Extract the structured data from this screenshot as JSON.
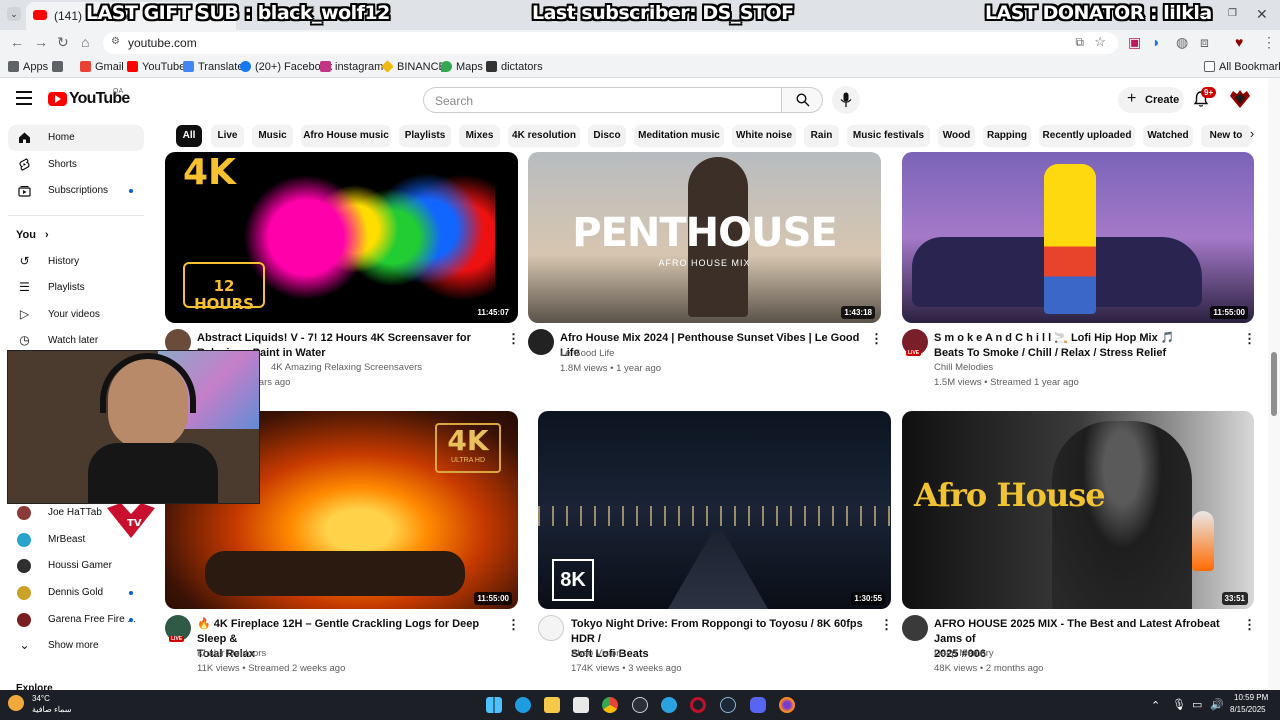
{
  "browser": {
    "tab_title": "(141) YouTube",
    "url": "youtube.com",
    "bookmarks": [
      {
        "label": "Apps",
        "color": "#5f6368"
      },
      {
        "label": "Gmail",
        "color": "#ea4335"
      },
      {
        "label": "YouTube",
        "color": "#ff0000"
      },
      {
        "label": "Translate",
        "color": "#4285f4"
      },
      {
        "label": "(20+) Facebook",
        "color": "#1877f2"
      },
      {
        "label": "instagram",
        "color": "#c13584"
      },
      {
        "label": "BINANCE",
        "color": "#f0b90b"
      },
      {
        "label": "Maps",
        "color": "#34a853"
      },
      {
        "label": "dictators",
        "color": "#333333"
      }
    ],
    "all_bookmarks": "All Bookmarks"
  },
  "stream_overlay": {
    "gift_sub": "LAST GIFT SUB : black_wolf12",
    "subscriber": "Last subscriber: DS_STOF",
    "donator": "LAST DONATOR : lilkla"
  },
  "header": {
    "logo_text": "YouTube",
    "region": "QA",
    "search_placeholder": "Search",
    "create_label": "Create",
    "notification_count": "9+"
  },
  "chips": [
    "All",
    "Live",
    "Music",
    "Afro House music",
    "Playlists",
    "Mixes",
    "4K resolution",
    "Disco",
    "Meditation music",
    "White noise",
    "Rain",
    "Music festivals",
    "Wood",
    "Rapping",
    "Recently uploaded",
    "Watched",
    "New to"
  ],
  "sidebar": {
    "primary": [
      {
        "label": "Home",
        "icon": "home-icon"
      },
      {
        "label": "Shorts",
        "icon": "shorts-icon"
      },
      {
        "label": "Subscriptions",
        "icon": "subscriptions-icon"
      }
    ],
    "you_label": "You",
    "you_items": [
      {
        "label": "History",
        "icon": "history-icon"
      },
      {
        "label": "Playlists",
        "icon": "playlists-icon"
      },
      {
        "label": "Your videos",
        "icon": "your-videos-icon"
      },
      {
        "label": "Watch later",
        "icon": "watch-later-icon"
      }
    ],
    "subscriptions": [
      {
        "label": "Joe HaTTab",
        "color": "#8b3a3a"
      },
      {
        "label": "MrBeast",
        "color": "#29a3c9"
      },
      {
        "label": "Houssi Gamer",
        "color": "#2f2f2f"
      },
      {
        "label": "Dennis Gold",
        "color": "#c9a227"
      },
      {
        "label": "Garena Free Fire ...",
        "color": "#7a1f1f"
      }
    ],
    "show_more": "Show more",
    "explore": "Explore"
  },
  "videos": [
    {
      "title_line1": "Abstract Liquids! V - 7! 12 Hours 4K Screensaver for",
      "title_line2": "Relaxing - Paint in Water",
      "channel": "4K Amazing Relaxing Screensavers",
      "stats": "Streamed 2 years ago",
      "duration": "11:45:07",
      "thumb_text": "4K",
      "thumb_text2": "12 HOURS"
    },
    {
      "title_line1": "Afro House Mix 2024 | Penthouse Sunset Vibes | Le Good Life",
      "title_line2": "",
      "channel": "Le Good Life",
      "stats": "1.8M views • 1 year ago",
      "duration": "1:43:18",
      "thumb_text": "PENTHOUSE",
      "thumb_text2": "AFRO HOUSE MIX"
    },
    {
      "title_line1": "S m o k e   A n d   C h i l l 🚬 Lofi Hip Hop Mix 🎵",
      "title_line2": "Beats To Smoke / Chill / Relax / Stress Relief",
      "channel": "Chill Melodies",
      "stats": "1.5M views • Streamed 1 year ago",
      "duration": "11:55:00",
      "thumb_text": "",
      "thumb_text2": ""
    },
    {
      "title_line1": "🔥 4K Fireplace 12H – Gentle Crackling Logs for Deep Sleep &",
      "title_line2": "Total Relax",
      "channel": "Khabir Outdoors",
      "stats": "11K views • Streamed 2 weeks ago",
      "duration": "11:55:00",
      "thumb_text": "4K",
      "thumb_text2": "ULTRA HD"
    },
    {
      "title_line1": "Tokyo Night Drive: From Roppongi to Toyosu / 8K 60fps HDR /",
      "title_line2": "Soft Lofi Beats",
      "channel": "Abao Vision",
      "stats": "174K views • 3 weeks ago",
      "duration": "1:30:55",
      "thumb_text": "8K",
      "thumb_text2": ""
    },
    {
      "title_line1": "AFRO HOUSE 2025 MIX - The Best and Latest Afrobeat Jams of",
      "title_line2": "2025 #006",
      "channel": "Deep Memory",
      "stats": "48K views • 2 months ago",
      "duration": "33:51",
      "thumb_text": "Afro House",
      "thumb_text2": ""
    }
  ],
  "live_badge": "LIVE",
  "taskbar": {
    "weather_temp": "34°C",
    "weather_desc": "سماء صافية",
    "time": "10:59 PM",
    "date": "8/15/2025"
  }
}
